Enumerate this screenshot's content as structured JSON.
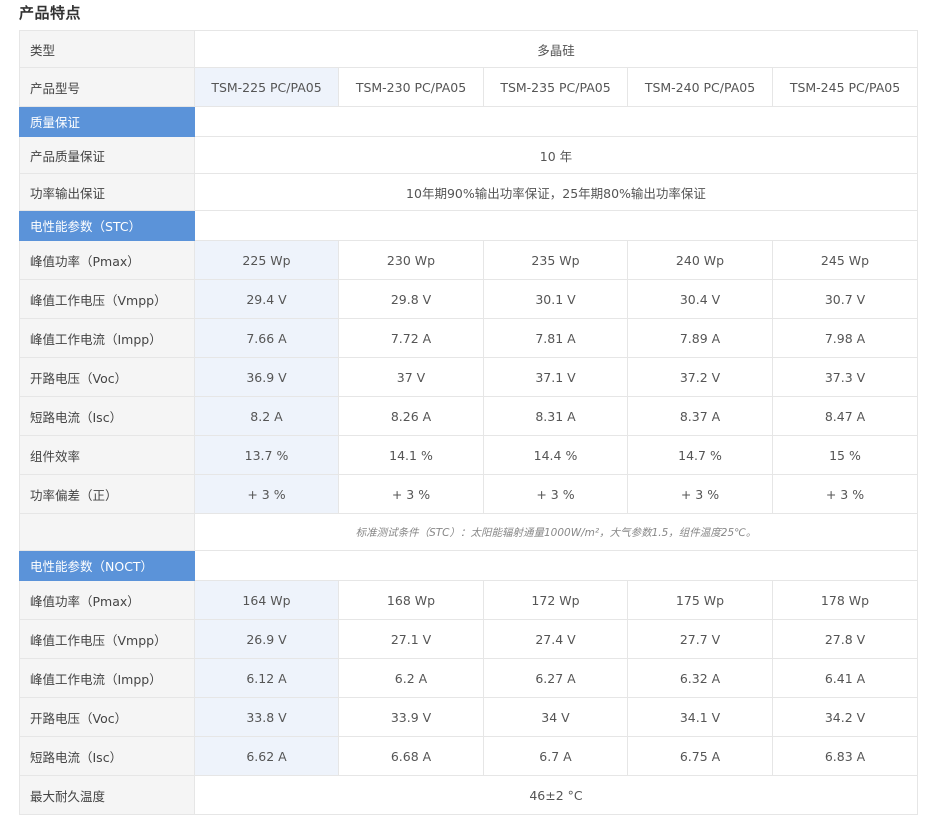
{
  "title": "产品特点",
  "type_row": {
    "label": "类型",
    "value": "多晶硅"
  },
  "model_row": {
    "label": "产品型号",
    "models": [
      "TSM-225 PC/PA05",
      "TSM-230 PC/PA05",
      "TSM-235 PC/PA05",
      "TSM-240 PC/PA05",
      "TSM-245 PC/PA05"
    ]
  },
  "warranty": {
    "section": "质量保证",
    "rows": [
      {
        "label": "产品质量保证",
        "value": "10 年"
      },
      {
        "label": "功率输出保证",
        "value": "10年期90%输出功率保证，25年期80%输出功率保证"
      }
    ]
  },
  "stc": {
    "section": "电性能参数（STC）",
    "rows": [
      {
        "label": "峰值功率（Pmax）",
        "values": [
          "225 Wp",
          "230 Wp",
          "235 Wp",
          "240 Wp",
          "245 Wp"
        ]
      },
      {
        "label": "峰值工作电压（Vmpp）",
        "values": [
          "29.4 V",
          "29.8 V",
          "30.1 V",
          "30.4 V",
          "30.7 V"
        ]
      },
      {
        "label": "峰值工作电流（Impp）",
        "values": [
          "7.66 A",
          "7.72 A",
          "7.81 A",
          "7.89 A",
          "7.98 A"
        ]
      },
      {
        "label": "开路电压（Voc）",
        "values": [
          "36.9 V",
          "37 V",
          "37.1 V",
          "37.2 V",
          "37.3 V"
        ]
      },
      {
        "label": "短路电流（Isc）",
        "values": [
          "8.2 A",
          "8.26 A",
          "8.31 A",
          "8.37 A",
          "8.47 A"
        ]
      },
      {
        "label": "组件效率",
        "values": [
          "13.7 %",
          "14.1 %",
          "14.4 %",
          "14.7 %",
          "15 %"
        ]
      },
      {
        "label": "功率偏差（正）",
        "values": [
          "+ 3 %",
          "+ 3 %",
          "+ 3 %",
          "+ 3 %",
          "+ 3 %"
        ]
      }
    ],
    "note": "标准测试条件（STC）：太阳能辐射通量1000W/m²，大气参数1.5，组件温度25℃。"
  },
  "noct": {
    "section": "电性能参数（NOCT）",
    "rows": [
      {
        "label": "峰值功率（Pmax）",
        "values": [
          "164 Wp",
          "168 Wp",
          "172 Wp",
          "175 Wp",
          "178 Wp"
        ]
      },
      {
        "label": "峰值工作电压（Vmpp）",
        "values": [
          "26.9 V",
          "27.1 V",
          "27.4 V",
          "27.7 V",
          "27.8 V"
        ]
      },
      {
        "label": "峰值工作电流（Impp）",
        "values": [
          "6.12 A",
          "6.2 A",
          "6.27 A",
          "6.32 A",
          "6.41 A"
        ]
      },
      {
        "label": "开路电压（Voc）",
        "values": [
          "33.8 V",
          "33.9 V",
          "34 V",
          "34.1 V",
          "34.2 V"
        ]
      },
      {
        "label": "短路电流（Isc）",
        "values": [
          "6.62 A",
          "6.68 A",
          "6.7 A",
          "6.75 A",
          "6.83 A"
        ]
      }
    ]
  },
  "max_temp": {
    "label": "最大耐久温度",
    "value": "46±2 °C"
  },
  "colors": {
    "section_bg": "#5b93d9",
    "highlight_col": "#eef3fb",
    "label_bg": "#f5f5f5"
  }
}
